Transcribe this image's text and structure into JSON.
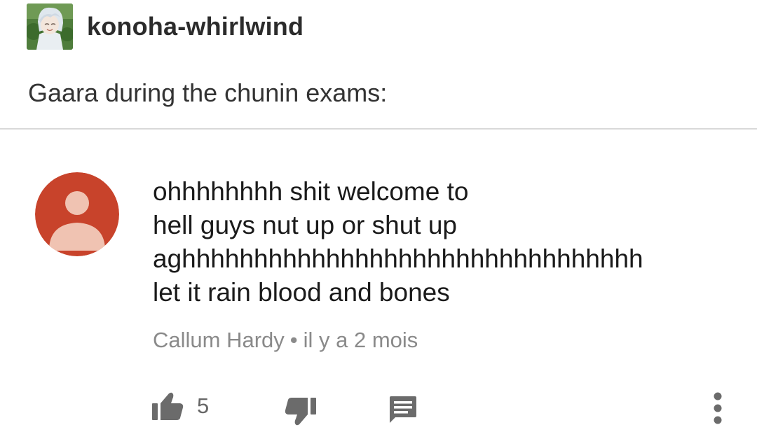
{
  "post": {
    "username": "konoha-whirlwind",
    "text": "Gaara during the chunin exams:"
  },
  "comment": {
    "lines": [
      "ohhhhhhhh shit welcome to",
      "hell guys nut up or shut up",
      "aghhhhhhhhhhhhhhhhhhhhhhhhhhhhhhhh",
      "let it rain blood and bones"
    ],
    "author": "Callum Hardy",
    "separator": "•",
    "time": "il y a 2 mois",
    "like_count": "5",
    "avatar_color": "#c8432b",
    "avatar_figure_color": "#f0c3b2"
  },
  "icons": {
    "like": "thumbs-up-icon",
    "dislike": "thumbs-down-icon",
    "reply": "comment-icon",
    "more": "more-vert-icon"
  },
  "colors": {
    "icon": "#6b6b6b",
    "meta_text": "#8a8a8a",
    "divider": "#d9d9d9"
  }
}
